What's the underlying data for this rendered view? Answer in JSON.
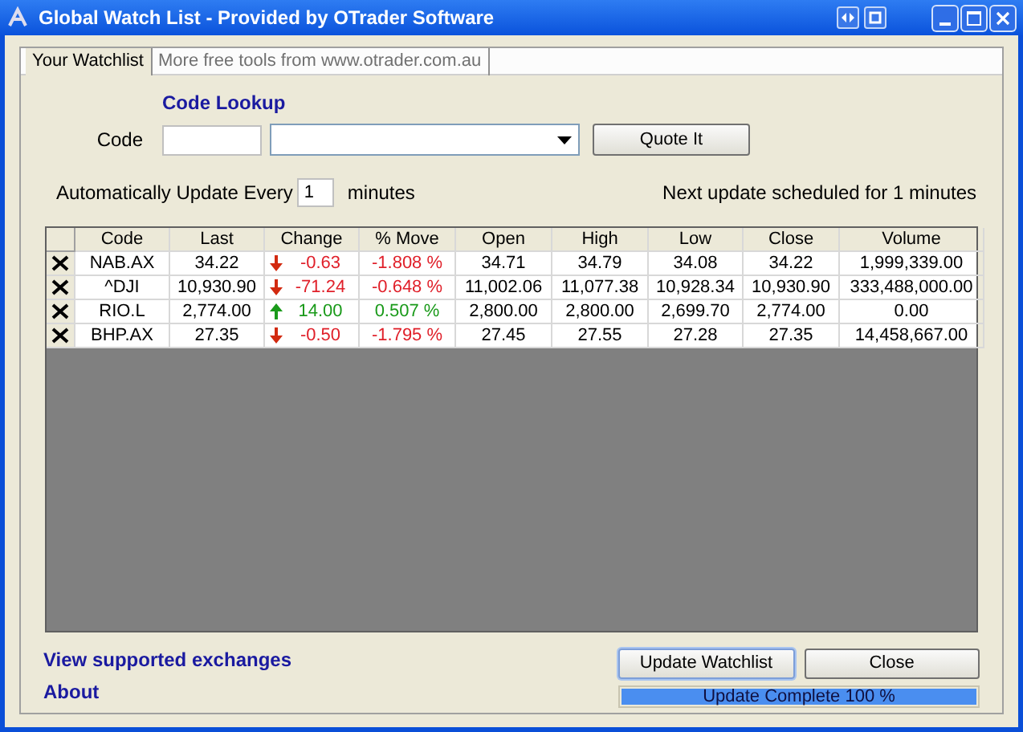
{
  "window": {
    "title": "Global Watch List - Provided by OTrader Software"
  },
  "tabs": [
    {
      "label": "Your Watchlist",
      "selected": true
    },
    {
      "label": "More free tools from www.otrader.com.au",
      "selected": false
    }
  ],
  "lookup": {
    "heading": "Code Lookup",
    "code_label": "Code",
    "button": "Quote It"
  },
  "auto_update": {
    "label": "Automatically Update Every",
    "value": "1",
    "unit": "minutes",
    "next": "Next update scheduled for 1 minutes"
  },
  "table": {
    "columns": [
      "Code",
      "Last",
      "Change",
      "% Move",
      "Open",
      "High",
      "Low",
      "Close",
      "Volume"
    ],
    "rows": [
      {
        "code": "NAB.AX",
        "last": "34.22",
        "kind": "down",
        "change": "-0.63",
        "move": "-1.808 %",
        "open": "34.71",
        "high": "34.79",
        "low": "34.08",
        "close": "34.22",
        "volume": "1,999,339.00"
      },
      {
        "code": "^DJI",
        "last": "10,930.90",
        "kind": "down",
        "change": "-71.24",
        "move": "-0.648 %",
        "open": "11,002.06",
        "high": "11,077.38",
        "low": "10,928.34",
        "close": "10,930.90",
        "volume": "333,488,000.00"
      },
      {
        "code": "RIO.L",
        "last": "2,774.00",
        "kind": "up",
        "change": "14.00",
        "move": "0.507 %",
        "open": "2,800.00",
        "high": "2,800.00",
        "low": "2,699.70",
        "close": "2,774.00",
        "volume": "0.00"
      },
      {
        "code": "BHP.AX",
        "last": "27.35",
        "kind": "down",
        "change": "-0.50",
        "move": "-1.795 %",
        "open": "27.45",
        "high": "27.55",
        "low": "27.28",
        "close": "27.35",
        "volume": "14,458,667.00"
      }
    ]
  },
  "links": [
    "View supported exchanges",
    "About"
  ],
  "buttons": [
    "Update Watchlist",
    "Close"
  ],
  "progress": {
    "label": "Update Complete 100 %",
    "level": 1
  }
}
